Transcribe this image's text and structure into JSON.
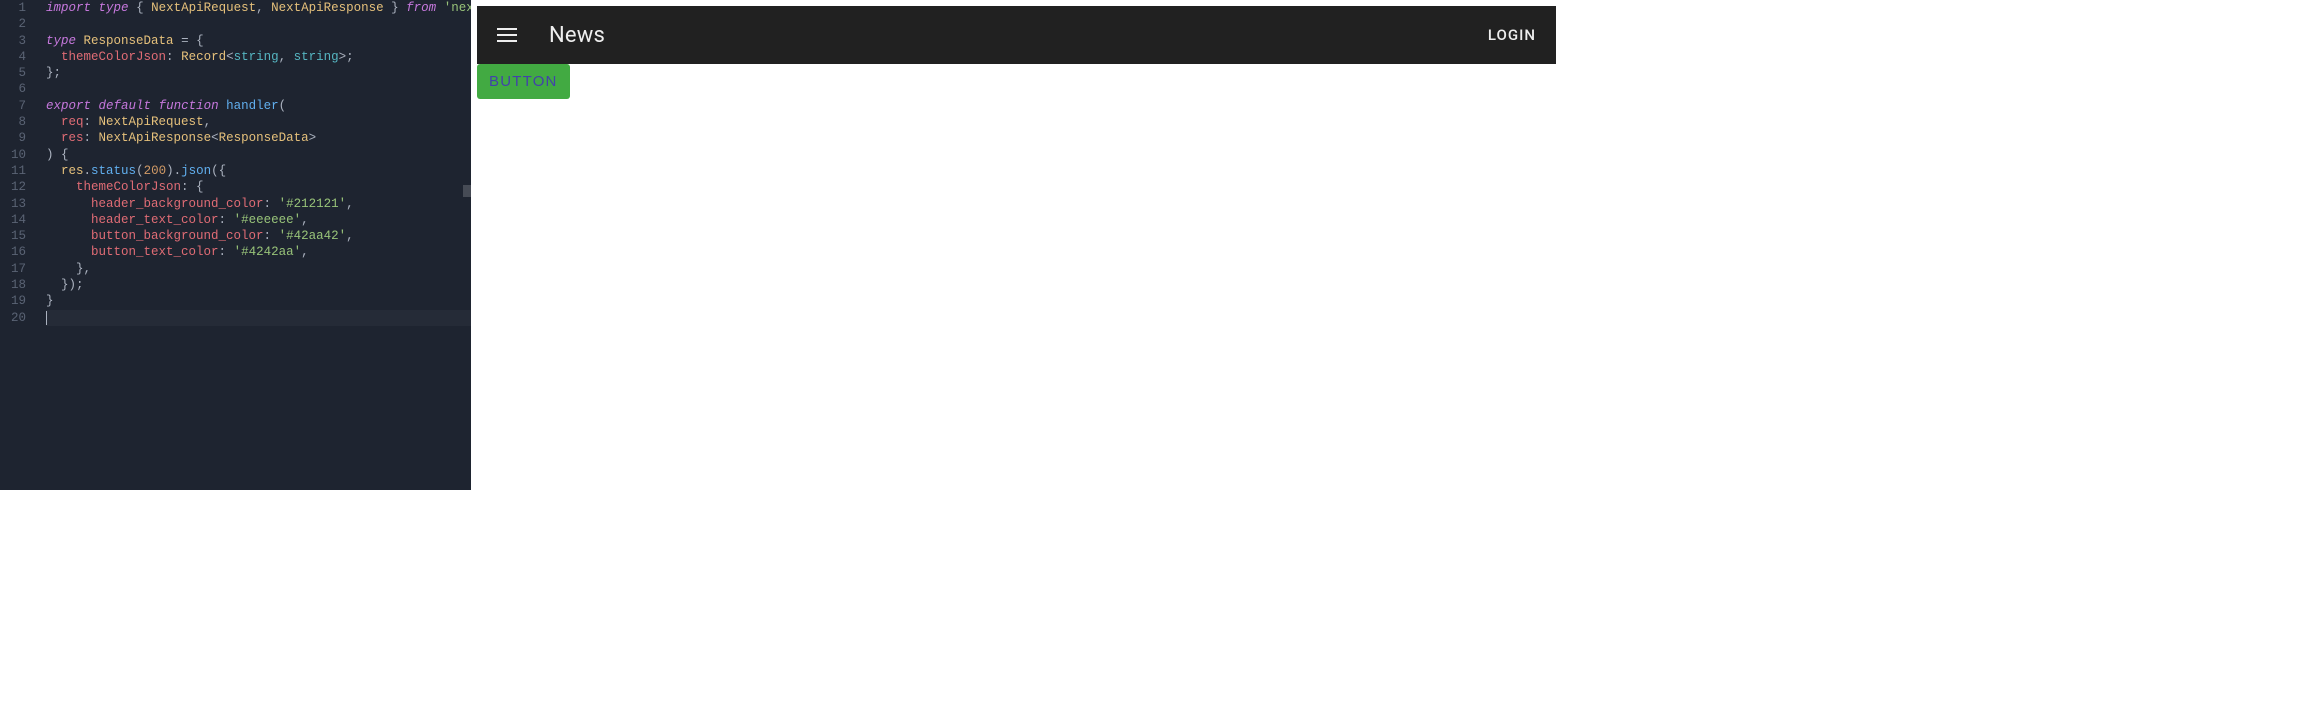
{
  "editor": {
    "language": "typescript",
    "active_line": 20,
    "lines": [
      {
        "n": 1,
        "tokens": [
          [
            "kw",
            "import"
          ],
          [
            "plain",
            " "
          ],
          [
            "kw",
            "type"
          ],
          [
            "plain",
            " "
          ],
          [
            "punct",
            "{ "
          ],
          [
            "type",
            "NextApiRequest"
          ],
          [
            "punct",
            ", "
          ],
          [
            "type",
            "NextApiResponse"
          ],
          [
            "punct",
            " } "
          ],
          [
            "kw",
            "from"
          ],
          [
            "plain",
            " "
          ],
          [
            "str",
            "'next'"
          ],
          [
            "punct",
            ";"
          ]
        ]
      },
      {
        "n": 2,
        "tokens": [
          [
            "plain",
            ""
          ]
        ]
      },
      {
        "n": 3,
        "tokens": [
          [
            "kw",
            "type"
          ],
          [
            "plain",
            " "
          ],
          [
            "type",
            "ResponseData"
          ],
          [
            "plain",
            " "
          ],
          [
            "punct",
            "= {"
          ]
        ]
      },
      {
        "n": 4,
        "tokens": [
          [
            "plain",
            "  "
          ],
          [
            "prop",
            "themeColorJson"
          ],
          [
            "punct",
            ": "
          ],
          [
            "type",
            "Record"
          ],
          [
            "punct",
            "<"
          ],
          [
            "typename",
            "string"
          ],
          [
            "punct",
            ", "
          ],
          [
            "typename",
            "string"
          ],
          [
            "punct",
            ">;"
          ]
        ]
      },
      {
        "n": 5,
        "tokens": [
          [
            "punct",
            "};"
          ]
        ]
      },
      {
        "n": 6,
        "tokens": [
          [
            "plain",
            ""
          ]
        ]
      },
      {
        "n": 7,
        "tokens": [
          [
            "kw",
            "export"
          ],
          [
            "plain",
            " "
          ],
          [
            "kw",
            "default"
          ],
          [
            "plain",
            " "
          ],
          [
            "kw",
            "function"
          ],
          [
            "plain",
            " "
          ],
          [
            "fn",
            "handler"
          ],
          [
            "punct",
            "("
          ]
        ]
      },
      {
        "n": 8,
        "tokens": [
          [
            "plain",
            "  "
          ],
          [
            "prop",
            "req"
          ],
          [
            "punct",
            ": "
          ],
          [
            "type",
            "NextApiRequest"
          ],
          [
            "punct",
            ","
          ]
        ]
      },
      {
        "n": 9,
        "tokens": [
          [
            "plain",
            "  "
          ],
          [
            "prop",
            "res"
          ],
          [
            "punct",
            ": "
          ],
          [
            "type",
            "NextApiResponse"
          ],
          [
            "punct",
            "<"
          ],
          [
            "type",
            "ResponseData"
          ],
          [
            "punct",
            ">"
          ]
        ]
      },
      {
        "n": 10,
        "tokens": [
          [
            "punct",
            ") {"
          ]
        ]
      },
      {
        "n": 11,
        "tokens": [
          [
            "plain",
            "  "
          ],
          [
            "var",
            "res"
          ],
          [
            "punct",
            "."
          ],
          [
            "fn",
            "status"
          ],
          [
            "punct",
            "("
          ],
          [
            "num",
            "200"
          ],
          [
            "punct",
            ")."
          ],
          [
            "fn",
            "json"
          ],
          [
            "punct",
            "({"
          ]
        ]
      },
      {
        "n": 12,
        "tokens": [
          [
            "plain",
            "    "
          ],
          [
            "prop",
            "themeColorJson"
          ],
          [
            "punct",
            ": {"
          ]
        ]
      },
      {
        "n": 13,
        "tokens": [
          [
            "plain",
            "      "
          ],
          [
            "prop",
            "header_background_color"
          ],
          [
            "punct",
            ": "
          ],
          [
            "str",
            "'#212121'"
          ],
          [
            "punct",
            ","
          ]
        ]
      },
      {
        "n": 14,
        "tokens": [
          [
            "plain",
            "      "
          ],
          [
            "prop",
            "header_text_color"
          ],
          [
            "punct",
            ": "
          ],
          [
            "str",
            "'#eeeeee'"
          ],
          [
            "punct",
            ","
          ]
        ]
      },
      {
        "n": 15,
        "tokens": [
          [
            "plain",
            "      "
          ],
          [
            "prop",
            "button_background_color"
          ],
          [
            "punct",
            ": "
          ],
          [
            "str",
            "'#42aa42'"
          ],
          [
            "punct",
            ","
          ]
        ]
      },
      {
        "n": 16,
        "tokens": [
          [
            "plain",
            "      "
          ],
          [
            "prop",
            "button_text_color"
          ],
          [
            "punct",
            ": "
          ],
          [
            "str",
            "'#4242aa'"
          ],
          [
            "punct",
            ","
          ]
        ]
      },
      {
        "n": 17,
        "tokens": [
          [
            "plain",
            "    "
          ],
          [
            "punct",
            "},"
          ]
        ]
      },
      {
        "n": 18,
        "tokens": [
          [
            "plain",
            "  "
          ],
          [
            "punct",
            "});"
          ]
        ]
      },
      {
        "n": 19,
        "tokens": [
          [
            "punct",
            "}"
          ]
        ]
      },
      {
        "n": 20,
        "tokens": [
          [
            "plain",
            ""
          ]
        ]
      }
    ]
  },
  "preview": {
    "header": {
      "title": "News",
      "login_label": "LOGIN",
      "bg_color": "#212121",
      "text_color": "#eeeeee"
    },
    "button": {
      "label": "BUTTON",
      "bg_color": "#42aa42",
      "text_color": "#4242aa"
    }
  }
}
